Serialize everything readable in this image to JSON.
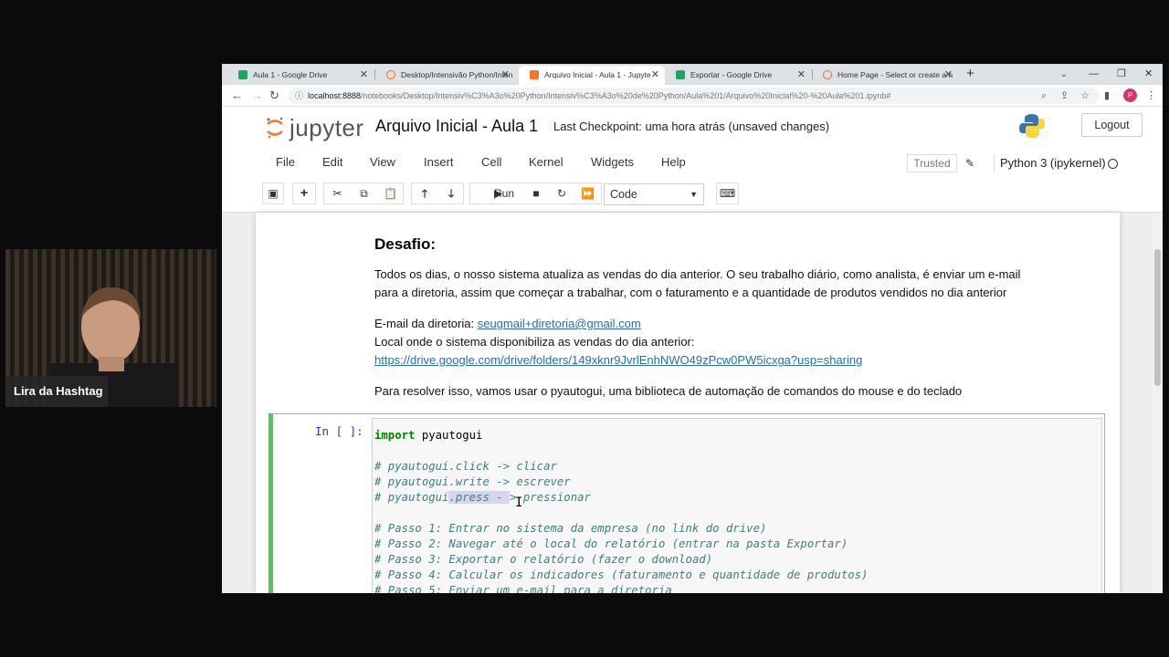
{
  "webcam": {
    "name_tag": "Lira da Hashtag"
  },
  "browser": {
    "tabs": [
      {
        "label": "Aula 1 - Google Drive",
        "color": "#1fa463"
      },
      {
        "label": "Desktop/Intensivão Python/Inten",
        "color": "#e8710a"
      },
      {
        "label": "Arquivo Inicial - Aula 1 - Jupyte",
        "color": "#f37726"
      },
      {
        "label": "Exportar - Google Drive",
        "color": "#1fa463"
      },
      {
        "label": "Home Page - Select or create a n",
        "color": "#e8710a"
      }
    ],
    "new_tab": "+",
    "address": {
      "host": "localhost:8888",
      "path": "/notebooks/Desktop/Intensiv%C3%A3o%20Python/Intensiv%C3%A3o%20de%20Python/Aula%201/Arquivo%20Inicial%20-%20Aula%201.ipynb#"
    },
    "avatar_letter": "P"
  },
  "jupyter": {
    "logo_text": "jupyter",
    "notebook_title": "Arquivo Inicial - Aula 1",
    "checkpoint": "Last Checkpoint: uma hora atrás  (unsaved changes)",
    "logout": "Logout",
    "menus": [
      "File",
      "Edit",
      "View",
      "Insert",
      "Cell",
      "Kernel",
      "Widgets",
      "Help"
    ],
    "trusted": "Trusted",
    "kernel_name": "Python 3 (ipykernel)",
    "run_label": "Run",
    "cell_type": "Code"
  },
  "markdown": {
    "heading": "Desafio:",
    "paragraph_line1": "Todos os dias, o nosso sistema atualiza as vendas do dia anterior. O seu trabalho diário, como analista, é enviar um e-mail",
    "paragraph_line2": "para a diretoria, assim que começar a trabalhar, com o faturamento e a quantidade de produtos vendidos no dia anterior",
    "email_label": "E-mail da diretoria: ",
    "email_link": "seugmail+diretoria@gmail.com",
    "local_label": "Local onde o sistema disponibiliza as vendas do dia anterior:",
    "drive_link": "https://drive.google.com/drive/folders/149xknr9JvrlEnhNWO49zPcw0PW5icxga?usp=sharing",
    "solution": "Para resolver isso, vamos usar o pyautogui, uma biblioteca de automação de comandos do mouse e do teclado"
  },
  "code_cell": {
    "prompt": "In [ ]:",
    "import_kw": "import",
    "import_mod": " pyautogui",
    "c1": "# pyautogui.click -> clicar",
    "c2": "# pyautogui.write -> escrever",
    "c3a": "# pyautogui",
    "c3sel": ".press - ",
    "c3b": "> pressionar",
    "p1": "# Passo 1: Entrar no sistema da empresa (no link do drive)",
    "p2": "# Passo 2: Navegar até o local do relatório (entrar na pasta Exportar)",
    "p3": "# Passo 3: Exportar o relatório (fazer o download)",
    "p4": "# Passo 4: Calcular os indicadores (faturamento e quantidade de produtos)",
    "p5": "# Passo 5: Enviar um e-mail para a diretoria"
  }
}
